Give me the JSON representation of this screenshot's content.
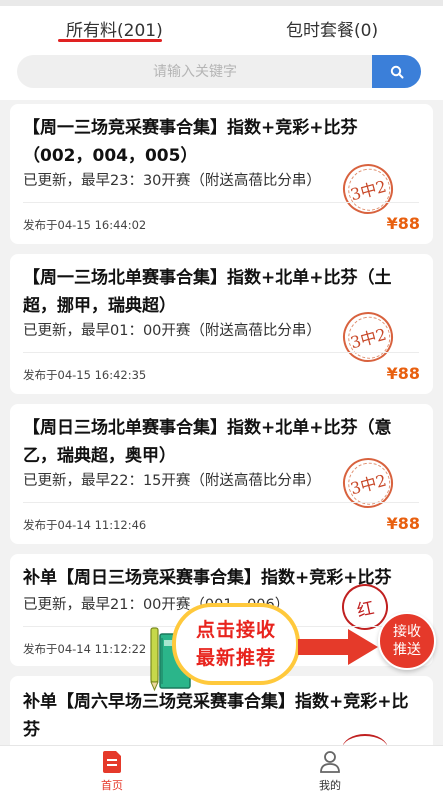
{
  "tabs": {
    "all": "所有料(201)",
    "package": "包时套餐(0)"
  },
  "search": {
    "placeholder": "请输入关键字",
    "button_icon": "search-icon"
  },
  "cards": [
    {
      "title": "【周一三场竞采赛事合集】指数+竞彩+比芬（002，004，005）",
      "subtitle": "已更新，最早23：30开赛（附送高蓓比分串）",
      "stamp": "3中2",
      "date": "发布于04-15 16:44:02",
      "price": "¥88"
    },
    {
      "title": "【周一三场北单赛事合集】指数+北单+比芬（土超，挪甲，瑞典超）",
      "subtitle": "已更新，最早01：00开赛（附送高蓓比分串）",
      "stamp": "3中2",
      "date": "发布于04-15 16:42:35",
      "price": "¥88"
    },
    {
      "title": "【周日三场北单赛事合集】指数+北单+比芬（意乙，瑞典超，奥甲）",
      "subtitle": "已更新，最早22：15开赛（附送高蓓比分串）",
      "stamp": "3中2",
      "date": "发布于04-14 11:12:46",
      "price": "¥88"
    },
    {
      "title": "补单【周日三场竞采赛事合集】指数+竞彩+比芬",
      "subtitle": "已更新，最早21：00开赛（001，006）",
      "stamp": "红",
      "date": "发布于04-14 11:12:22"
    },
    {
      "title": "补单【周六早场三场竞采赛事合集】指数+竞彩+比芬"
    }
  ],
  "promo": {
    "line1": "点击接收",
    "line2": "最新推荐",
    "button_line1": "接收",
    "button_line2": "推送"
  },
  "nav": {
    "home": "首页",
    "mine": "我的",
    "active_color": "#e5392a"
  }
}
